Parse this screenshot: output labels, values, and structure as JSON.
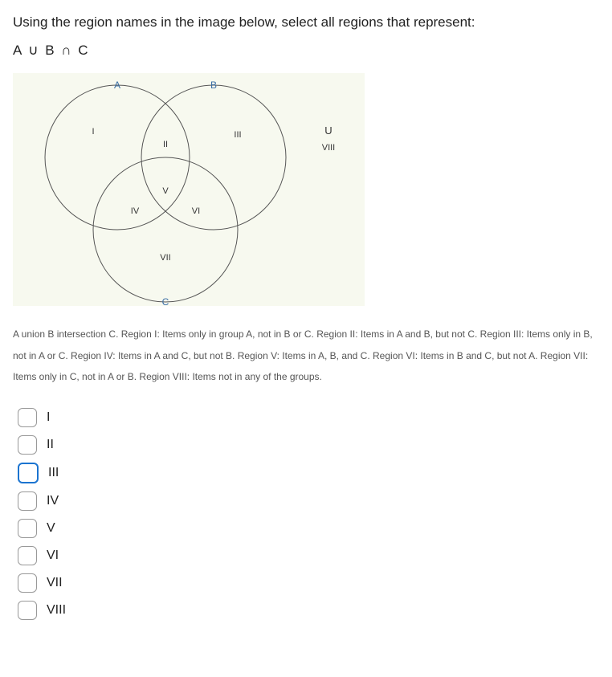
{
  "question": "Using the region names in the image below, select all regions that represent:",
  "formula": "A ∪ B ∩ C",
  "venn": {
    "labelA": "A",
    "labelB": "B",
    "labelC": "C",
    "labelU": "U",
    "r1": "I",
    "r2": "II",
    "r3": "III",
    "r4": "IV",
    "r5": "V",
    "r6": "VI",
    "r7": "VII",
    "r8": "VIII"
  },
  "description": "A union B intersection C. Region I: Items only in group A, not in B or C. Region II: Items in A and B, but not C. Region III: Items only in B, not in A or C. Region IV: Items in A and C, but not B. Region V: Items in A, B, and C. Region VI: Items in B and C, but not A. Region VII: Items only in C, not in A or B. Region VIII: Items not in any of the groups.",
  "options": [
    {
      "label": "I",
      "selected": false
    },
    {
      "label": "II",
      "selected": false
    },
    {
      "label": "III",
      "selected": true
    },
    {
      "label": "IV",
      "selected": false
    },
    {
      "label": "V",
      "selected": false
    },
    {
      "label": "VI",
      "selected": false
    },
    {
      "label": "VII",
      "selected": false
    },
    {
      "label": "VIII",
      "selected": false
    }
  ]
}
